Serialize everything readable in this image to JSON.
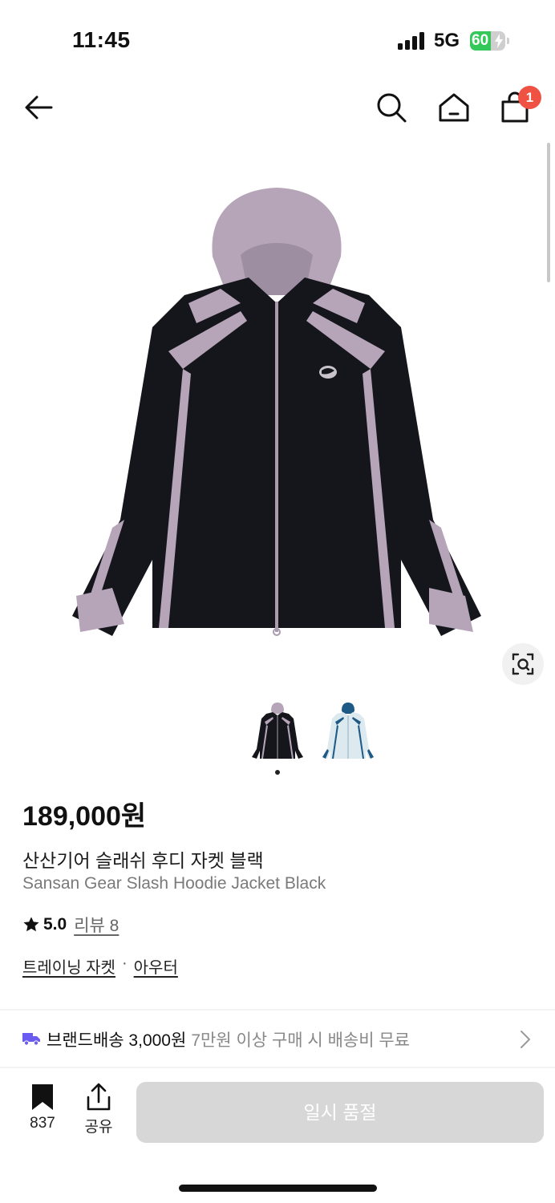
{
  "status_bar": {
    "time": "11:45",
    "network": "5G",
    "battery_level": "60",
    "battery_fraction": 0.6
  },
  "nav": {
    "cart_badge": "1",
    "icons": [
      "back-arrow-icon",
      "search-icon",
      "home-icon",
      "shopping-bag-icon"
    ]
  },
  "product": {
    "price": "189,000원",
    "name_ko": "산산기어 슬래쉬 후디 자켓 블랙",
    "name_en": "Sansan Gear Slash Hoodie Jacket Black",
    "rating": "5.0",
    "review_label": "리뷰 8",
    "categories": [
      "트레이닝 자켓",
      "아우터"
    ],
    "category_separator": "·",
    "thumbnails": [
      "black-lavender-jacket",
      "light-blue-jacket"
    ],
    "selected_thumbnail": 0
  },
  "delivery": {
    "label": "브랜드배송 3,000원",
    "note": "7만원 이상 구매 시 배송비 무료"
  },
  "bottom": {
    "bookmark_count": "837",
    "share_label": "공유",
    "buy_button": "일시 품절"
  },
  "colors": {
    "badge": "#ef5242",
    "battery": "#34c759",
    "jacket_body": "#15151c",
    "jacket_accent": "#b6a5b8",
    "soldout_button": "#d7d7d7"
  }
}
